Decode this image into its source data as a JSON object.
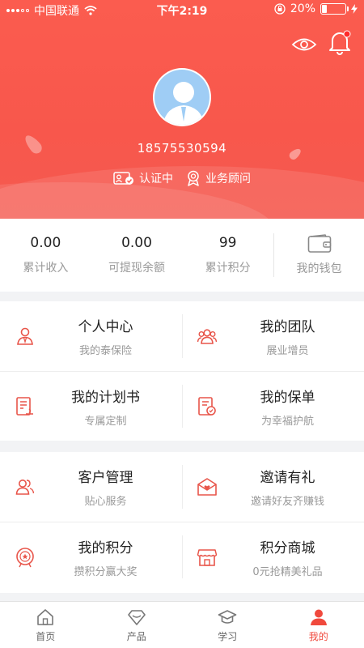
{
  "status_bar": {
    "carrier": "中国联通",
    "time": "下午2:19",
    "battery_text": "20%",
    "battery_level": 0.2
  },
  "profile": {
    "phone": "18575530594",
    "verify_label": "认证中",
    "role_label": "业务顾问",
    "icons": {
      "eye": "eye-icon",
      "bell": "bell-icon",
      "avatar": "user-avatar-icon"
    }
  },
  "stats": [
    {
      "value": "0.00",
      "label": "累计收入"
    },
    {
      "value": "0.00",
      "label": "可提现余额"
    },
    {
      "value": "99",
      "label": "累计积分"
    }
  ],
  "wallet": {
    "label": "我的钱包",
    "icon": "wallet-icon"
  },
  "menu_group_1": [
    {
      "title": "个人中心",
      "subtitle": "我的泰保险",
      "icon": "person-icon"
    },
    {
      "title": "我的团队",
      "subtitle": "展业增员",
      "icon": "team-icon"
    },
    {
      "title": "我的计划书",
      "subtitle": "专属定制",
      "icon": "plan-document-icon"
    },
    {
      "title": "我的保单",
      "subtitle": "为幸福护航",
      "icon": "policy-icon"
    }
  ],
  "menu_group_2": [
    {
      "title": "客户管理",
      "subtitle": "贴心服务",
      "icon": "customers-icon"
    },
    {
      "title": "邀请有礼",
      "subtitle": "邀请好友齐赚钱",
      "icon": "invite-envelope-icon"
    },
    {
      "title": "我的积分",
      "subtitle": "攒积分赢大奖",
      "icon": "points-medal-icon"
    },
    {
      "title": "积分商城",
      "subtitle": "0元抢精美礼品",
      "icon": "store-icon"
    }
  ],
  "tabbar": [
    {
      "label": "首页",
      "icon": "home-icon",
      "active": false
    },
    {
      "label": "产品",
      "icon": "product-gem-icon",
      "active": false
    },
    {
      "label": "学习",
      "icon": "study-cap-icon",
      "active": false
    },
    {
      "label": "我的",
      "icon": "profile-icon",
      "active": true
    }
  ],
  "colors": {
    "accent": "#f8574c",
    "icon_red": "#e8554a",
    "active_tab": "#f0493d"
  }
}
